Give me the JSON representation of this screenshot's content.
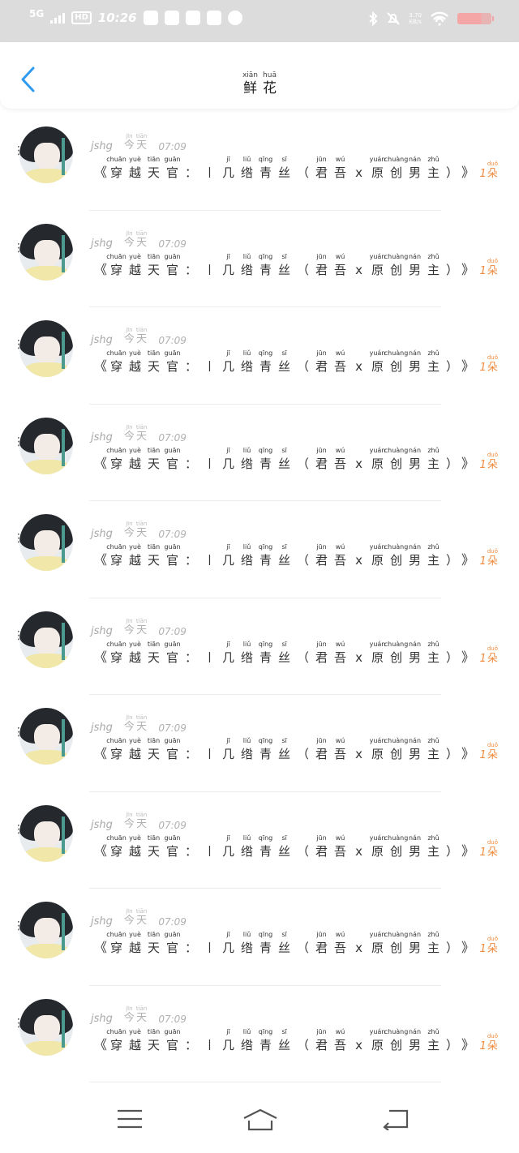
{
  "status_bar": {
    "network": "5G",
    "hd": "HD",
    "time": "10:26",
    "speed_value": "3.70",
    "speed_unit": "KB/s",
    "battery_color": "#f4a6a6"
  },
  "header": {
    "title": [
      {
        "py": "xiān",
        "hz": "鲜"
      },
      {
        "py": "huā",
        "hz": "花"
      }
    ],
    "back_icon": "chevron-left-icon",
    "accent_color": "#2e9bf0"
  },
  "items": [
    {
      "username": "jshg",
      "date": [
        {
          "py": "jīn",
          "hz": "今"
        },
        {
          "py": "tiān",
          "hz": "天"
        }
      ],
      "time": "07:09",
      "open_bracket": "《",
      "title_chars": [
        {
          "py": "chuān",
          "hz": "穿"
        },
        {
          "py": "yuè",
          "hz": "越"
        },
        {
          "py": "tiān",
          "hz": "天"
        },
        {
          "py": "guān",
          "hz": "官"
        }
      ],
      "colon": "：",
      "subtitle_chars": [
        {
          "py": "",
          "hz": "〡"
        },
        {
          "py": "jī",
          "hz": "几"
        },
        {
          "py": "liǔ",
          "hz": "绺"
        },
        {
          "py": "qīng",
          "hz": "青"
        },
        {
          "py": "sī",
          "hz": "丝"
        }
      ],
      "paren_open": "（",
      "note_chars": [
        {
          "py": "jūn",
          "hz": "君"
        },
        {
          "py": "wú",
          "hz": "吾"
        },
        {
          "py": "",
          "hz": "x"
        },
        {
          "py": "yuán",
          "hz": "原"
        },
        {
          "py": "chuàng",
          "hz": "创"
        },
        {
          "py": "nán",
          "hz": "男"
        },
        {
          "py": "zhǔ",
          "hz": "主"
        }
      ],
      "paren_close": "）",
      "close_bracket": "》",
      "count": "1",
      "unit": {
        "py": "duǒ",
        "hz": "朵"
      }
    }
  ],
  "repeat": 10,
  "colors": {
    "flower": "#f08a3c",
    "muted": "#b0b0b0",
    "divider": "#ededed"
  },
  "nav": {
    "menu_icon": "menu-icon",
    "home_icon": "home-icon",
    "back_icon": "back-icon"
  }
}
